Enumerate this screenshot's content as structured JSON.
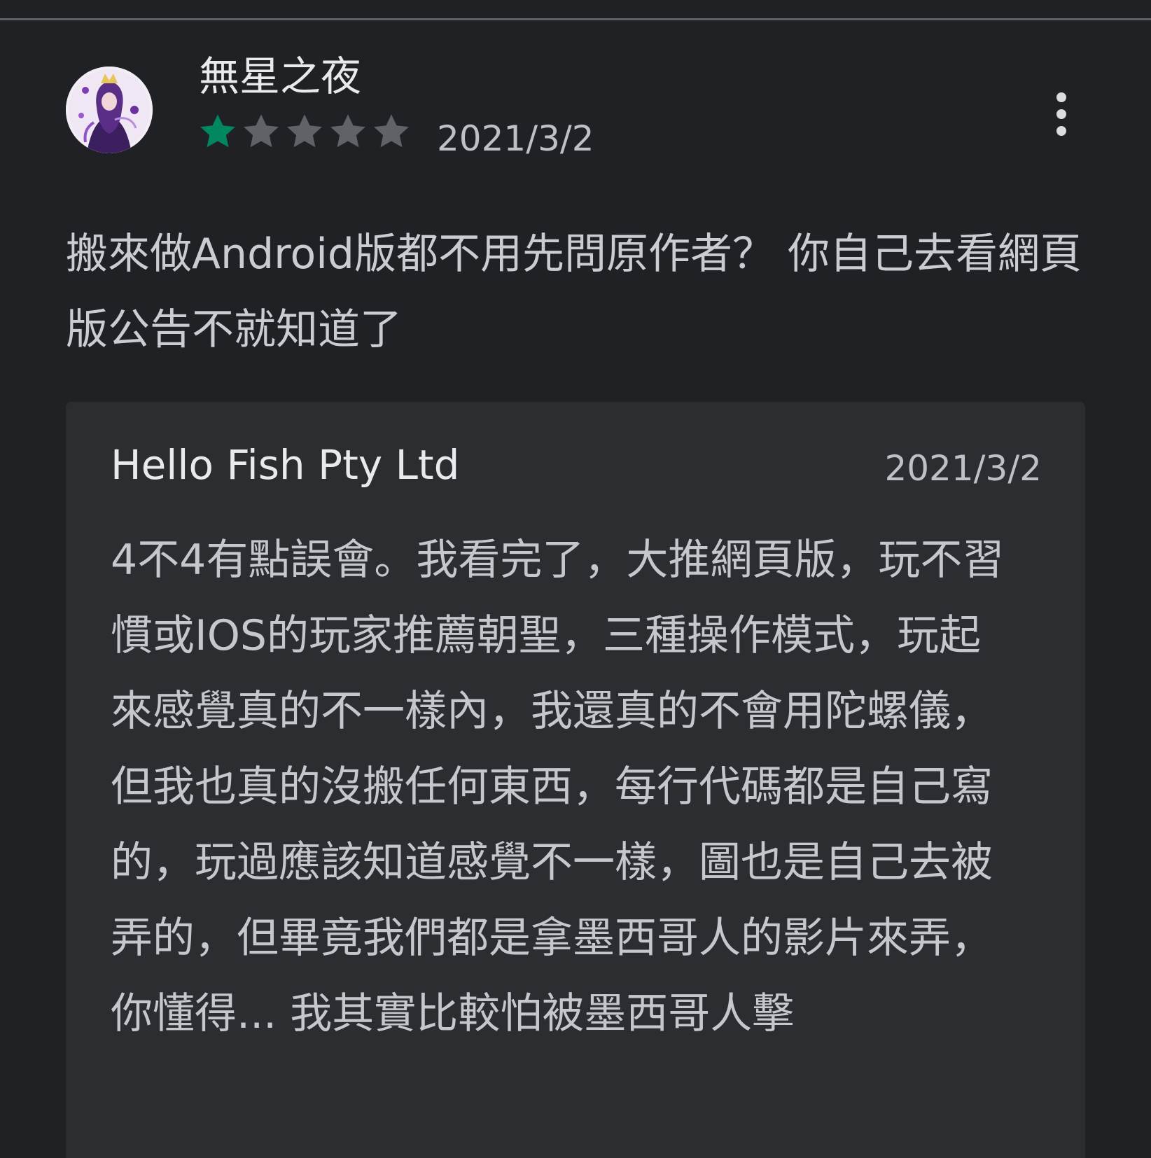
{
  "review": {
    "reviewer_name": "無星之夜",
    "rating": 1,
    "max_rating": 5,
    "date": "2021/3/2",
    "text": "搬來做Android版都不用先問原作者？ 你自己去看網頁版公告不就知道了",
    "more_icon": "more-vert-icon",
    "star_icon": "star-icon"
  },
  "reply": {
    "author": "Hello Fish Pty Ltd",
    "date": "2021/3/2",
    "text": "4不4有點誤會。我看完了，大推網頁版，玩不習慣或IOS的玩家推薦朝聖，三種操作模式，玩起來感覺真的不一樣內，我還真的不會用陀螺儀，但我也真的沒搬任何東西，每行代碼都是自己寫的，玩過應該知道感覺不一樣，圖也是自己去被弄的，但畢竟我們都是拿墨西哥人的影片來弄，你懂得... 我其實比較怕被墨西哥人擊"
  },
  "colors": {
    "background": "#202124",
    "card": "#2c2d31",
    "star_filled": "#01875f",
    "star_empty": "#5f6368",
    "text_primary": "#e8eaed",
    "text_secondary": "#bdc1c6"
  }
}
